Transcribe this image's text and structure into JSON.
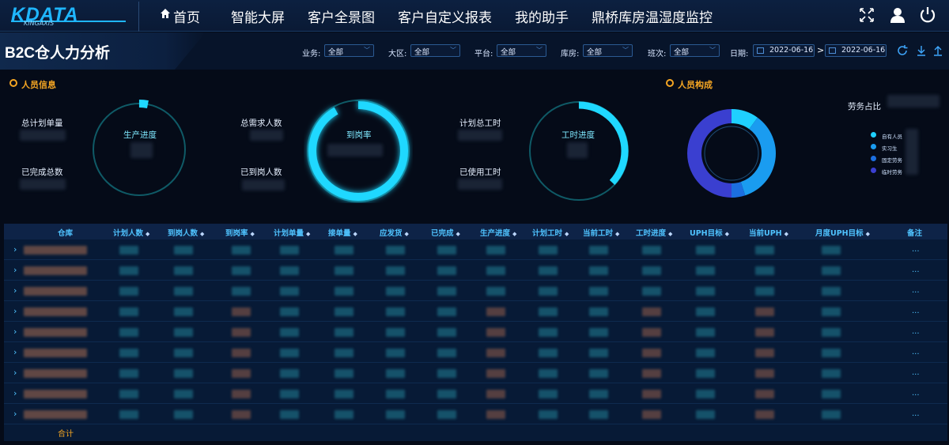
{
  "logo": {
    "text": "KDATA",
    "sub": "KINGAXIS"
  },
  "nav": {
    "home": "首页",
    "items": [
      "智能大屏",
      "客户全景图",
      "客户自定义报表",
      "我的助手",
      "鼎桥库房温湿度监控"
    ]
  },
  "top_icons": [
    "fullscreen-icon",
    "user-icon",
    "power-icon"
  ],
  "page_title": "B2C仓人力分析",
  "filters": {
    "business": {
      "label": "业务:",
      "value": "全部"
    },
    "region": {
      "label": "大区:",
      "value": "全部"
    },
    "platform": {
      "label": "平台:",
      "value": "全部"
    },
    "warehouse": {
      "label": "库房:",
      "value": "全部"
    },
    "shift": {
      "label": "班次:",
      "value": "全部"
    },
    "date": {
      "label": "日期:",
      "start": "2022-06-16",
      "separator": ">",
      "end": "2022-06-16"
    }
  },
  "filter_icons": [
    "refresh-icon",
    "download-icon",
    "upload-icon"
  ],
  "sections": {
    "staff_info": "人员信息",
    "staff_composition": "人员构成"
  },
  "staff_info": {
    "total_plan_orders": "总计划单量",
    "completed_total": "已完成总数",
    "total_demand": "总需求人数",
    "arrived": "已到岗人数",
    "plan_hours": "计划总工时",
    "used_hours": "已使用工时",
    "gauges": [
      {
        "name": "生产进度",
        "value": 0.03
      },
      {
        "name": "到岗率",
        "value": 0.92
      },
      {
        "name": "工时进度",
        "value": 0.37
      }
    ]
  },
  "composition": {
    "labor_ratio": "劳务占比",
    "legend": [
      {
        "label": "自有人员",
        "color": "#1fd0ff"
      },
      {
        "label": "实习生",
        "color": "#1a9cf0"
      },
      {
        "label": "固定劳务",
        "color": "#1c6fe0"
      },
      {
        "label": "临时劳务",
        "color": "#3a3fd0"
      }
    ],
    "donut": [
      0.1,
      0.35,
      0.05,
      0.5
    ]
  },
  "table": {
    "columns": [
      "仓库",
      "计划人数",
      "到岗人数",
      "到岗率",
      "计划单量",
      "接单量",
      "应发货",
      "已完成",
      "生产进度",
      "计划工时",
      "当前工时",
      "工时进度",
      "UPH目标",
      "当前UPH",
      "月度UPH目标",
      "备注"
    ],
    "more": "...",
    "total": "合计"
  }
}
